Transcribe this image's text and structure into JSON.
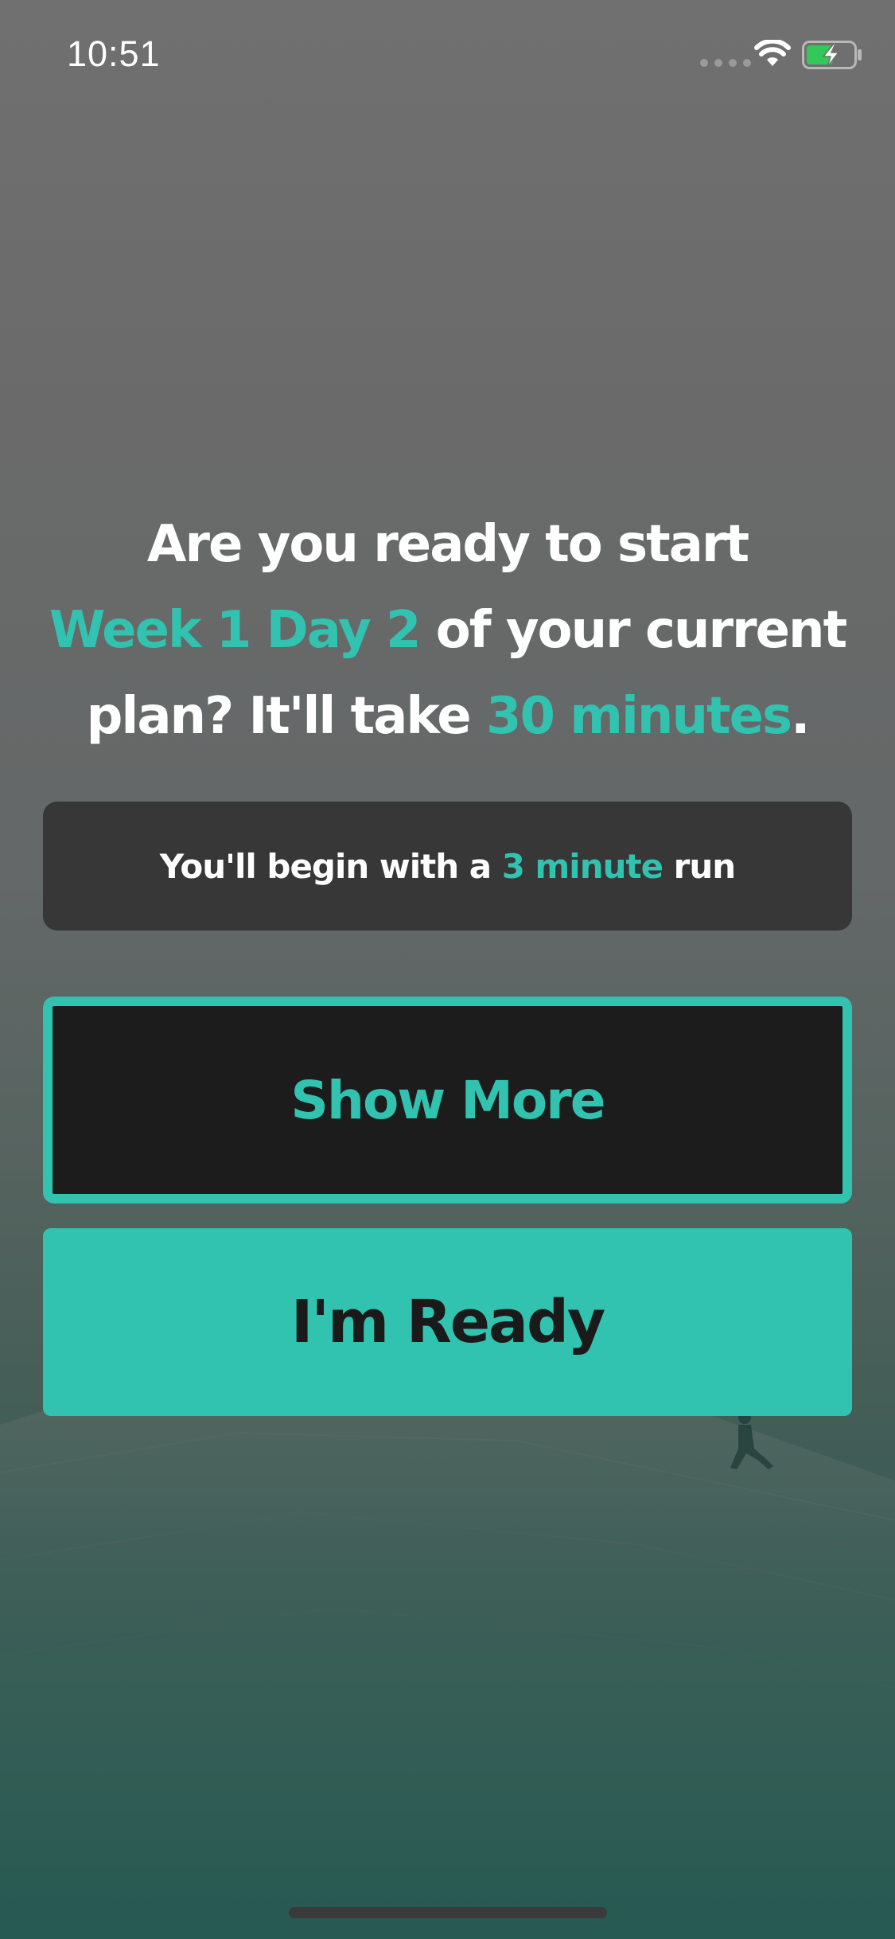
{
  "status_bar": {
    "time": "10:51",
    "icons": [
      "signal-dots-icon",
      "wifi-icon",
      "battery-charging-icon"
    ],
    "battery_color": "#34c759"
  },
  "headline": {
    "line1": "Are you ready to start",
    "week_day": "Week 1 Day 2",
    "line2_rest": " of your current",
    "line3_start": "plan? It'll take ",
    "duration": "30 minutes",
    "period": "."
  },
  "info": {
    "prefix": "You'll begin with a ",
    "highlight": "3 minute",
    "suffix": " run"
  },
  "buttons": {
    "show_more": "Show More",
    "ready": "I'm Ready"
  },
  "colors": {
    "accent": "#31c2b0",
    "info_box_bg": "#373737",
    "show_more_bg": "#1c1c1c",
    "ready_text": "#1a1a1a"
  }
}
